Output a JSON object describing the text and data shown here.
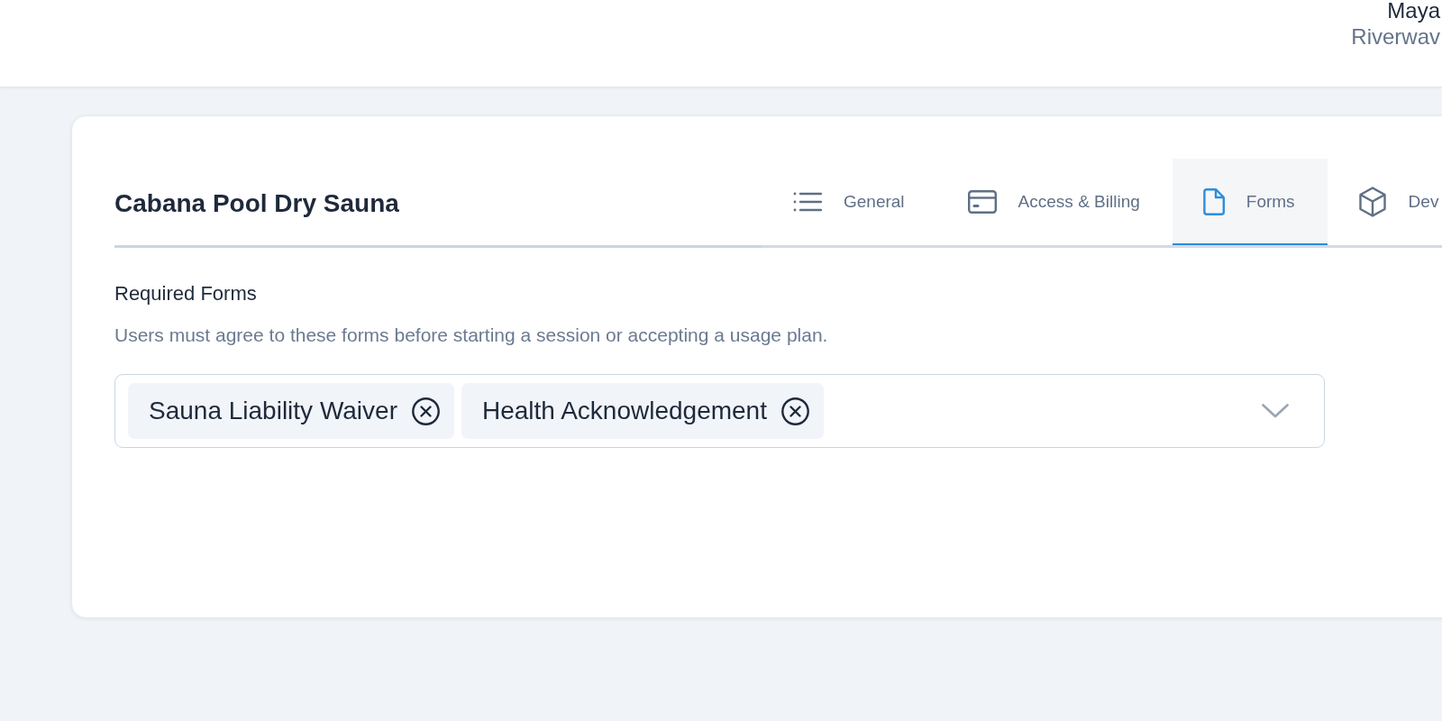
{
  "header": {
    "user_name": "Maya",
    "organization": "Riverwav"
  },
  "card": {
    "title": "Cabana Pool Dry Sauna",
    "tabs": [
      {
        "label": "General",
        "selected": false
      },
      {
        "label": "Access & Billing",
        "selected": false
      },
      {
        "label": "Forms",
        "selected": true
      },
      {
        "label": "Dev",
        "selected": false
      }
    ],
    "section": {
      "label": "Required Forms",
      "description": "Users must agree to these forms before starting a session or accepting a usage plan.",
      "selected_forms": [
        {
          "label": "Sauna Liability Waiver"
        },
        {
          "label": "Health Acknowledgement"
        }
      ]
    }
  }
}
